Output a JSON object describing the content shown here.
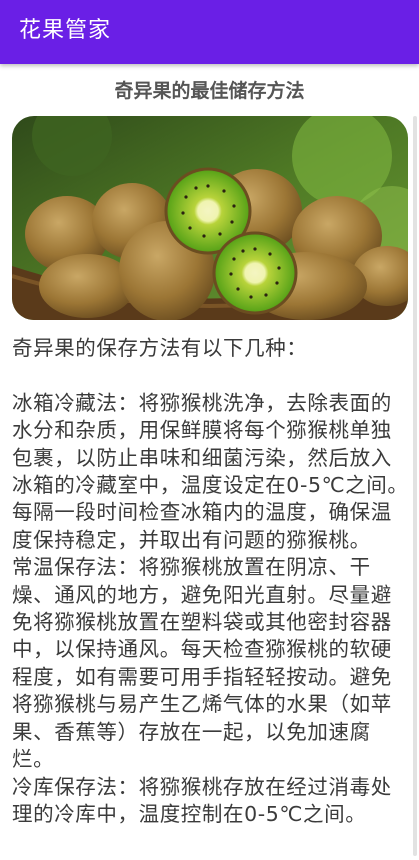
{
  "app": {
    "title": "花果管家"
  },
  "article": {
    "title": "奇异果的最佳储存方法",
    "image_alt": "kiwi-fruit-basket",
    "body": "奇异果的保存方法有以下几种：\n\n冰箱冷藏法：将猕猴桃洗净，去除表面的水分和杂质，用保鲜膜将每个猕猴桃单独包裹，以防止串味和细菌污染，然后放入冰箱的冷藏室中，温度设定在0-5℃之间。每隔一段时间检查冰箱内的温度，确保温度保持稳定，并取出有问题的猕猴桃。\n常温保存法：将猕猴桃放置在阴凉、干燥、通风的地方，避免阳光直射。尽量避免将猕猴桃放置在塑料袋或其他密封容器中，以保持通风。每天检查猕猴桃的软硬程度，如有需要可用手指轻轻按动。避免将猕猴桃与易产生乙烯气体的水果（如苹果、香蕉等）存放在一起，以免加速腐烂。\n冷库保存法：将猕猴桃存放在经过消毒处理的冷库中，温度控制在0-5℃之间。"
  },
  "colors": {
    "appbar": "#6a1fe6",
    "appbar_text": "#ffffff",
    "title_text": "#555555",
    "body_text": "#3b3b3b"
  }
}
